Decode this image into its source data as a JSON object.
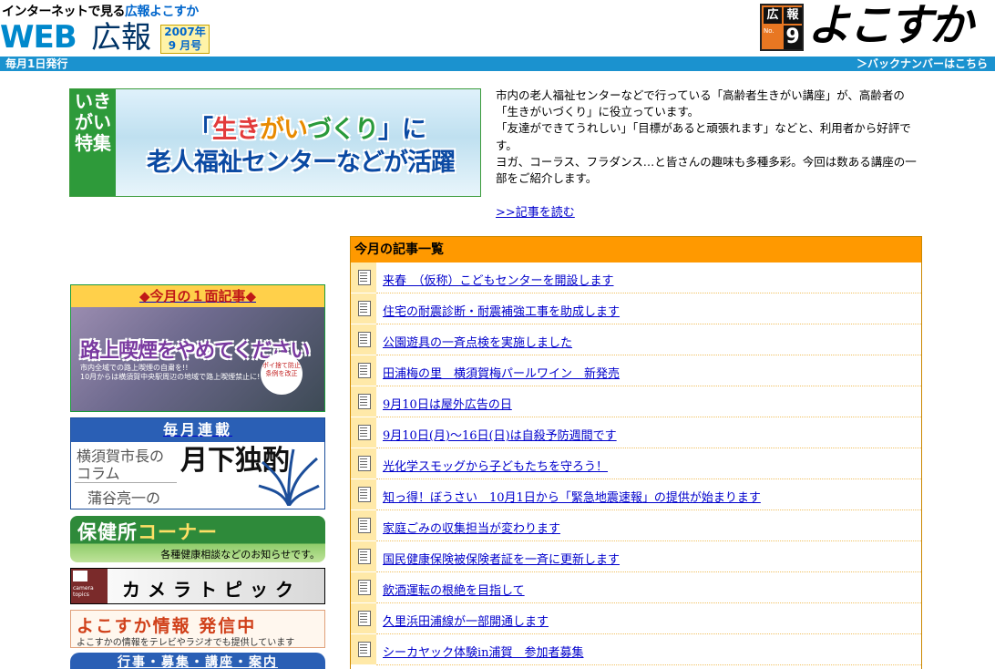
{
  "header": {
    "tagline_prefix": "インターネットで見る",
    "tagline_highlight": "広報よこすか",
    "logo_web": "WEB",
    "logo_kouhou": "広報",
    "issue_year": "2007年",
    "issue_month": "9 月号",
    "brand_k": "広",
    "brand_h": "報",
    "brand_num": "9",
    "brand_no": "No.",
    "brand_name": "よこすか"
  },
  "bar": {
    "left": "毎月1日発行",
    "right": "＞バックナンバーはこちら"
  },
  "feature": {
    "side_label": "いきがい特集",
    "title_line1_a": "「",
    "title_line1_b": "生き",
    "title_line1_c": "がい",
    "title_line1_d": "づくり",
    "title_line1_e": "」に",
    "title_line2": "老人福祉センターなどが活躍",
    "intro": [
      "市内の老人福祉センターなどで行っている「高齢者生きがい講座」が、高齢者の「生きがいづくり」に役立っています。",
      "「友達ができてうれしい」「目標があると頑張れます」などと、利用者から好評です。",
      "ヨガ、コーラス、フラダンス…と皆さんの趣味も多種多彩。今回は数ある講座の一部をご紹介します。"
    ],
    "read_more": ">>記事を読む"
  },
  "banners": {
    "front_header": "◆今月の１面記事◆",
    "front_title": "路上喫煙をやめてください",
    "front_sub_1": "市内全域での路上喫煙の自粛を!!",
    "front_sub_2": "10月からは横須賀中央駅周辺の地域で路上喫煙禁止に!",
    "front_badge": "ポイ捨て防止条例を改正",
    "column_header": "毎月連載",
    "column_line1": "横須賀市長の",
    "column_line2": "コラム",
    "column_author": "蒲谷亮一の",
    "column_title": "月下独酌",
    "health_title_a": "保健所",
    "health_title_b": "コーナー",
    "health_sub": "各種健康相談などのお知らせです。",
    "camera_icon_text": "camera topics",
    "camera_title": "カメラトピックス",
    "info_title": "よこすか情報 発信中",
    "info_sub": "よこすかの情報をテレビやラジオでも提供しています",
    "events_title": "行事・募集・講座・案内"
  },
  "articles": {
    "header": "今月の記事一覧",
    "items": [
      "来春　（仮称）こどもセンターを開設します",
      "住宅の耐震診断・耐震補強工事を助成します",
      "公園遊具の一斉点検を実施しました",
      "田浦梅の里　横須賀梅パールワイン　新発売",
      "9月10日は屋外広告の日",
      "9月10日(月)〜16日(日)は自殺予防週間です",
      "光化学スモッグから子どもたちを守ろう！",
      "知っ得！ぼうさい　10月1日から「緊急地震速報」の提供が始まります",
      "家庭ごみの収集担当が変わります",
      "国民健康保険被保険者証を一斉に更新します",
      "飲酒運転の根絶を目指して",
      "久里浜田浦線が一部開通します",
      "シーカヤック体験in浦賀　参加者募集"
    ]
  }
}
